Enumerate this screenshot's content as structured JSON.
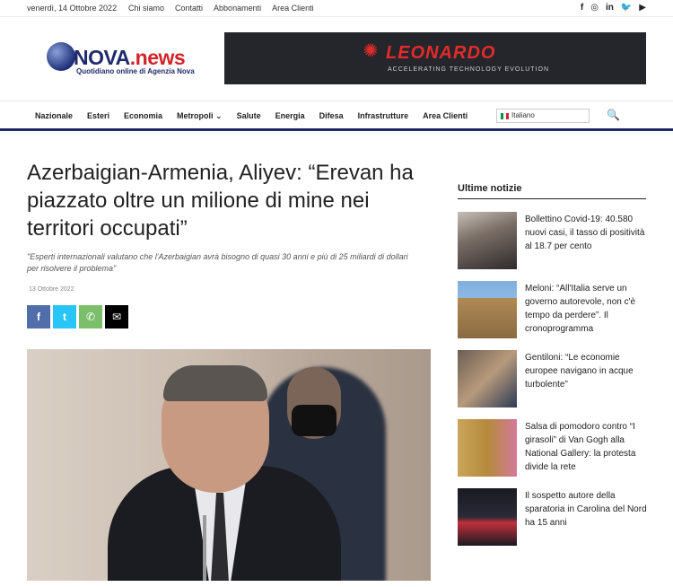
{
  "topbar": {
    "date": "venerdì, 14 Ottobre 2022",
    "links": [
      "Chi siamo",
      "Contatti",
      "Abbonamenti",
      "Area Clienti"
    ],
    "social": [
      "f",
      "◎",
      "in",
      "🐦",
      "▶"
    ]
  },
  "logo": {
    "name_part1": "NOVA",
    "name_part2": ".news",
    "tagline": "Quotidiano online di Agenzia Nova"
  },
  "banner": {
    "brand": "LEONARDO",
    "claim": "ACCELERATING TECHNOLOGY EVOLUTION"
  },
  "nav": {
    "items": [
      "Nazionale",
      "Esteri",
      "Economia",
      "Metropoli ⌄",
      "Salute",
      "Energia",
      "Difesa",
      "Infrastrutture",
      "Area Clienti"
    ],
    "language": "Italiano"
  },
  "article": {
    "headline": "Azerbaigian-Armenia, Aliyev: “Erevan ha piazzato oltre un milione di mine nei territori occupati”",
    "subtitle": "\"Esperti internazionali valutano che l'Azerbaigian avrà bisogno di quasi 30 anni e più di 25 miliardi di dollari per risolvere il problema\"",
    "date": "13 Ottobre 2022",
    "share": {
      "facebook": "f",
      "twitter": "t",
      "whatsapp": "✆",
      "email": "✉"
    }
  },
  "sidebar": {
    "title": "Ultime notizie",
    "items": [
      {
        "text": "Bollettino Covid-19: 40.580 nuovi casi, il tasso di positività al 18.7 per cento"
      },
      {
        "text": "Meloni: “All'Italia serve un governo autorevole, non c'è tempo da perdere”. Il cronoprogramma"
      },
      {
        "text": "Gentiloni: “Le economie europee navigano in acque turbolente”"
      },
      {
        "text": "Salsa di pomodoro contro “I girasoli” di Van Gogh alla National Gallery: la protesta divide la rete"
      },
      {
        "text": "Il sospetto autore della sparatoria in Carolina del Nord ha 15 anni"
      }
    ]
  },
  "colors": {
    "brand_navy": "#1f2a6b",
    "brand_red": "#d2232a",
    "facebook": "#516eab",
    "twitter": "#29c5f6",
    "whatsapp": "#7bbf6a"
  }
}
